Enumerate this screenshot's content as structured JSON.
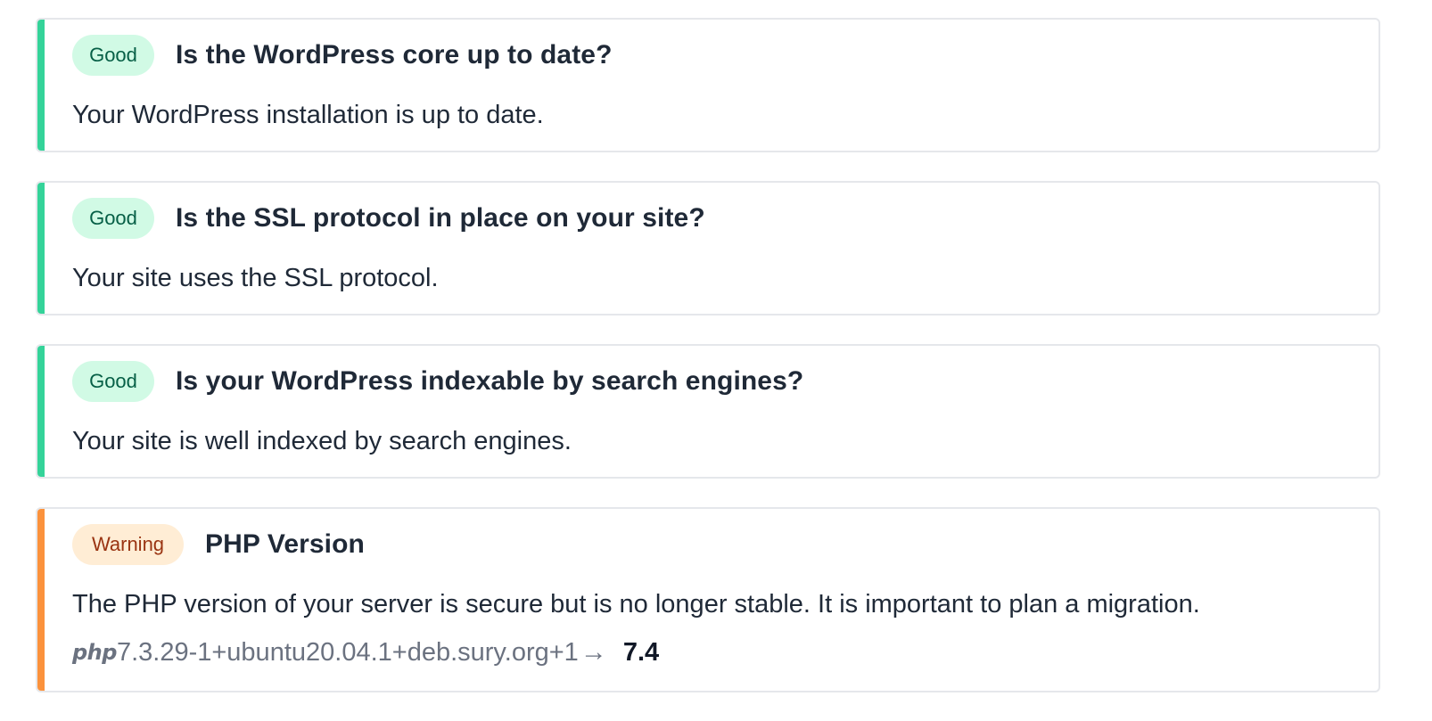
{
  "checks": [
    {
      "status": "Good",
      "title": "Is the WordPress core up to date?",
      "description": "Your WordPress installation is up to date."
    },
    {
      "status": "Good",
      "title": "Is the SSL protocol in place on your site?",
      "description": "Your site uses the SSL protocol."
    },
    {
      "status": "Good",
      "title": "Is your WordPress indexable by search engines?",
      "description": "Your site is well indexed by search engines."
    },
    {
      "status": "Warning",
      "title": "PHP Version",
      "description": "The PHP version of your server is secure but is no longer stable. It is important to plan a migration.",
      "php": {
        "logo_text": "php",
        "current_version": "7.3.29-1+ubuntu20.04.1+deb.sury.org+1",
        "arrow": "→",
        "target_version": "7.4"
      }
    }
  ],
  "colors": {
    "good_accent": "#34d399",
    "good_badge_bg": "#d1fae5",
    "good_badge_text": "#065f46",
    "warning_accent": "#fb923c",
    "warning_badge_bg": "#ffedd5",
    "warning_badge_text": "#9a3412"
  }
}
